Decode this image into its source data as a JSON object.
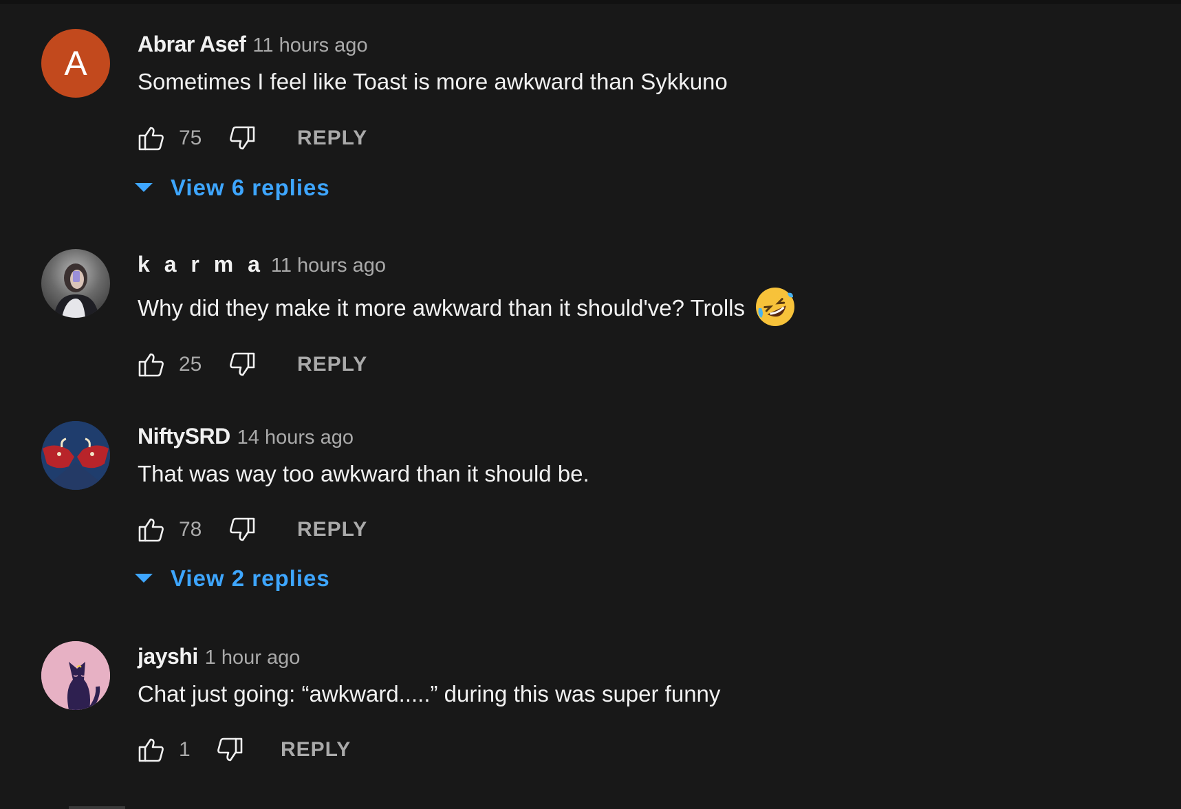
{
  "comments": [
    {
      "avatar_letter": "A",
      "avatar_color": "#c2491d",
      "author": "Abrar Asef",
      "time": "11 hours ago",
      "text": "Sometimes I feel like Toast is more awkward than Sykkuno",
      "likes": "75",
      "reply_label": "REPLY",
      "view_replies": "View 6 replies"
    },
    {
      "author": "k a r m a",
      "time": "11 hours ago",
      "text": "Why did they make it more awkward than it should've? Trolls",
      "emoji": "rolling-on-floor-laughing-emoji",
      "likes": "25",
      "reply_label": "REPLY"
    },
    {
      "author": "NiftySRD",
      "time": "14 hours ago",
      "text": "That was way too awkward than it should be.",
      "likes": "78",
      "reply_label": "REPLY",
      "view_replies": "View 2 replies"
    },
    {
      "author": "jayshi",
      "time": "1 hour ago",
      "text": "Chat just going: “awkward.....” during this was super funny",
      "likes": "1",
      "reply_label": "REPLY"
    }
  ],
  "colors": {
    "background": "#181818",
    "link_blue": "#3ea6ff",
    "secondary_text": "#aaaaaa"
  },
  "icons": [
    "thumbs-up-icon",
    "thumbs-down-icon",
    "caret-down-icon"
  ]
}
